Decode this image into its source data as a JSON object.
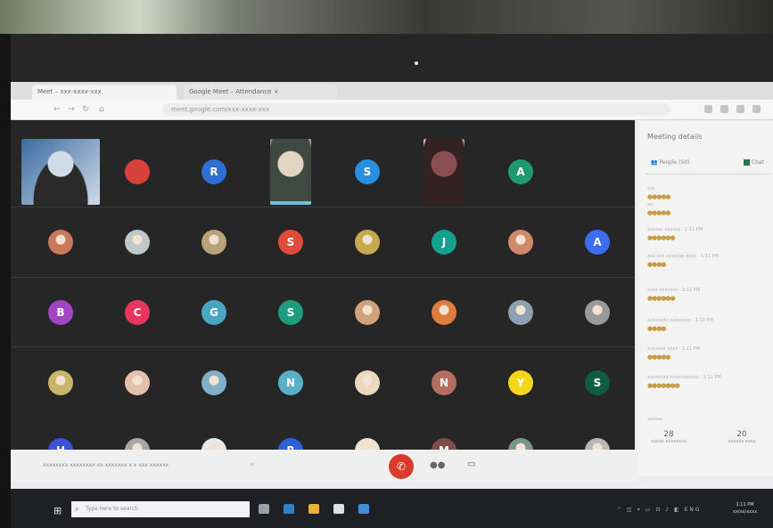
{
  "browser": {
    "tabs": [
      {
        "label": "Meet – xxx-xxxx-xxx"
      },
      {
        "label": "Google Meet – Attendance ×"
      }
    ],
    "url": "meet.google.com/xxx-xxxx-xxx"
  },
  "stage": {
    "tiles": [
      {
        "kind": "video",
        "name": "participant-video-1",
        "colors": [
          "#3a6ba0",
          "#d0dbe8",
          "#2a2a2a"
        ]
      },
      {
        "kind": "avatar",
        "letter": "",
        "color": "#d8413b"
      },
      {
        "kind": "avatar",
        "letter": "R",
        "color": "#2f6fd1"
      },
      {
        "kind": "video",
        "name": "participant-video-2",
        "colors": [
          "#7b8f7d",
          "#e3d5c2",
          "#3e4a41"
        ],
        "speaking": true
      },
      {
        "kind": "avatar",
        "letter": "S",
        "color": "#2b8fe0"
      },
      {
        "kind": "video",
        "name": "participant-video-3",
        "colors": [
          "#cfc7c0",
          "#8a4f55",
          "#332222"
        ]
      },
      {
        "kind": "avatar",
        "letter": "A",
        "color": "#1d9b6f"
      },
      {
        "kind": "empty"
      },
      {
        "kind": "photo",
        "color": "#c9795a"
      },
      {
        "kind": "photo",
        "color": "#bfc7c9"
      },
      {
        "kind": "photo",
        "color": "#b9a27a"
      },
      {
        "kind": "avatar",
        "letter": "S",
        "color": "#e04b3f"
      },
      {
        "kind": "photo",
        "color": "#c4a94d"
      },
      {
        "kind": "avatar",
        "letter": "J",
        "color": "#13a08c"
      },
      {
        "kind": "photo",
        "color": "#d08a6a"
      },
      {
        "kind": "avatar",
        "letter": "A",
        "color": "#3d6cf0"
      },
      {
        "kind": "avatar",
        "letter": "B",
        "color": "#a145c4"
      },
      {
        "kind": "avatar",
        "letter": "C",
        "color": "#e8355b"
      },
      {
        "kind": "avatar",
        "letter": "G",
        "color": "#47a6c4"
      },
      {
        "kind": "avatar",
        "letter": "S",
        "color": "#1e9c80"
      },
      {
        "kind": "photo",
        "color": "#d2a27c"
      },
      {
        "kind": "photo",
        "color": "#e07b3f"
      },
      {
        "kind": "photo",
        "color": "#8da1b4"
      },
      {
        "kind": "photo",
        "color": "#9a9a9a"
      },
      {
        "kind": "photo",
        "color": "#c9b46c"
      },
      {
        "kind": "photo",
        "color": "#e1c1ad"
      },
      {
        "kind": "photo",
        "color": "#82b0c8"
      },
      {
        "kind": "avatar",
        "letter": "N",
        "color": "#5bb0c9"
      },
      {
        "kind": "photo",
        "color": "#ecd9c2"
      },
      {
        "kind": "avatar",
        "letter": "N",
        "color": "#b56e60"
      },
      {
        "kind": "avatar",
        "letter": "Y",
        "color": "#f3d51a"
      },
      {
        "kind": "avatar",
        "letter": "S",
        "color": "#0f5c45"
      },
      {
        "kind": "avatar",
        "letter": "H",
        "color": "#3b51d6"
      },
      {
        "kind": "photo",
        "color": "#a7a7a7"
      },
      {
        "kind": "photo",
        "color": "#e8e8e8"
      },
      {
        "kind": "avatar",
        "letter": "R",
        "color": "#2d61d9"
      },
      {
        "kind": "photo",
        "color": "#e9e3d0"
      },
      {
        "kind": "avatar",
        "letter": "M",
        "color": "#7d4e48"
      },
      {
        "kind": "photo",
        "color": "#7a9687"
      },
      {
        "kind": "photo",
        "color": "#b7b7b7"
      }
    ]
  },
  "panel": {
    "title": "Meeting details",
    "tabs": [
      {
        "label": "People (50)"
      },
      {
        "label": "Chat"
      }
    ],
    "items": [
      {
        "label": "xxx",
        "dots": "●●●●●"
      },
      {
        "label": "xx",
        "dots": "●●●●●"
      },
      {
        "label": "xxxxxx xxxxxx · 1:11 PM",
        "dots": "●●●●●●"
      },
      {
        "label": "xxx xxx xxxxxxx xxxx · 1:11 PM",
        "dots": "●●●●"
      },
      {
        "label": "xxxx xxxxxxx · 1:11 PM",
        "dots": "●●●●●●"
      },
      {
        "label": "xxxxxxxx xxxxxxxx · 1:11 PM",
        "dots": "●●●●"
      },
      {
        "label": "xxxxxxx xxxx · 1:11 PM",
        "dots": "●●●●●"
      },
      {
        "label": "xxxxxxxx xxxxxxxxxxx · 1:11 PM",
        "dots": "●●●●●●●"
      }
    ],
    "footer_label": "xxxxxx",
    "counters": [
      {
        "value": "28",
        "label": "xxxxx xxxxxxxx"
      },
      {
        "value": "20",
        "label": "xxxxxx xxxx"
      }
    ]
  },
  "controls": {
    "notice": "xxxxxxxx xxxxxxxx xx xxxxxxx x x xxx xxxxxx",
    "hangup_icon": "phone-hangup-icon",
    "more_icon": "more-dots-icon",
    "chat_icon": "captions-icon"
  },
  "taskbar": {
    "search_placeholder": "Type here to search",
    "time": "1:11 PM",
    "date": "xx/xx/xxxx",
    "apps": [
      {
        "name": "task-view",
        "color": "#9aa0a6"
      },
      {
        "name": "edge",
        "color": "#2d82c7"
      },
      {
        "name": "file-explorer",
        "color": "#e6b03a"
      },
      {
        "name": "store",
        "color": "#e0e0e0"
      },
      {
        "name": "mail",
        "color": "#3e8ed9"
      }
    ]
  }
}
